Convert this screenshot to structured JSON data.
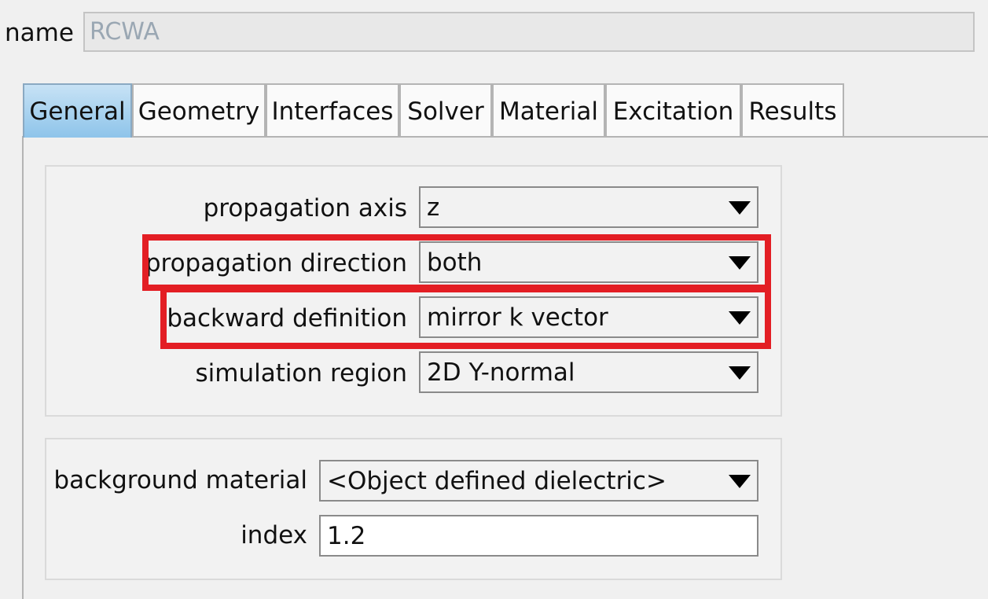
{
  "name": {
    "label": "name",
    "value": "RCWA"
  },
  "tabs": [
    {
      "label": "General",
      "active": true
    },
    {
      "label": "Geometry",
      "active": false
    },
    {
      "label": "Interfaces",
      "active": false
    },
    {
      "label": "Solver",
      "active": false
    },
    {
      "label": "Material",
      "active": false
    },
    {
      "label": "Excitation",
      "active": false
    },
    {
      "label": "Results",
      "active": false
    }
  ],
  "general": {
    "propagation_axis": {
      "label": "propagation axis",
      "value": "z"
    },
    "propagation_direction": {
      "label": "propagation direction",
      "value": "both"
    },
    "backward_definition": {
      "label": "backward definition",
      "value": "mirror k vector"
    },
    "simulation_region": {
      "label": "simulation region",
      "value": "2D Y-normal"
    }
  },
  "material": {
    "background_material": {
      "label": "background material",
      "value": "<Object defined dielectric>"
    },
    "index": {
      "label": "index",
      "value": "1.2"
    }
  },
  "highlight_color": "#e31e24"
}
